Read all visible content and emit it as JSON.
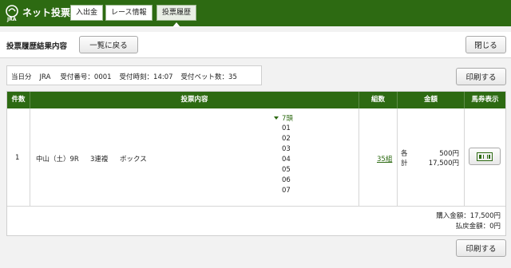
{
  "header": {
    "logo_text": "ネット投票",
    "logo_sub": "JRA",
    "tabs": [
      {
        "label": "入出金",
        "active": false
      },
      {
        "label": "レース情報",
        "active": false
      },
      {
        "label": "投票履歴",
        "active": true
      }
    ]
  },
  "titlebar": {
    "title": "投票履歴結果内容",
    "back_label": "一覧に戻る",
    "close_label": "閉じる"
  },
  "info": {
    "day": "当日分",
    "org": "JRA",
    "receipt_no": "受付番号：0001",
    "receipt_time": "受付時刻：14:07",
    "bet_count": "受付ベット数：35"
  },
  "print_label": "印刷する",
  "table": {
    "headers": [
      "件数",
      "投票内容",
      "組数",
      "金額",
      "馬券表示"
    ],
    "rows": [
      {
        "index": "1",
        "race": "中山（土）9R",
        "bet_type": "3連複",
        "method": "ボックス",
        "selection_label": "7頭",
        "horses": [
          "01",
          "02",
          "03",
          "04",
          "05",
          "06",
          "07"
        ],
        "combinations": "35組",
        "amount_each_label": "各",
        "amount_each": "500円",
        "amount_total_label": "計",
        "amount_total": "17,500円"
      }
    ],
    "purchase_total": "購入金額：17,500円",
    "refund_total": "払戻金額：0円"
  },
  "colors": {
    "brand_green": "#2d6a12"
  }
}
